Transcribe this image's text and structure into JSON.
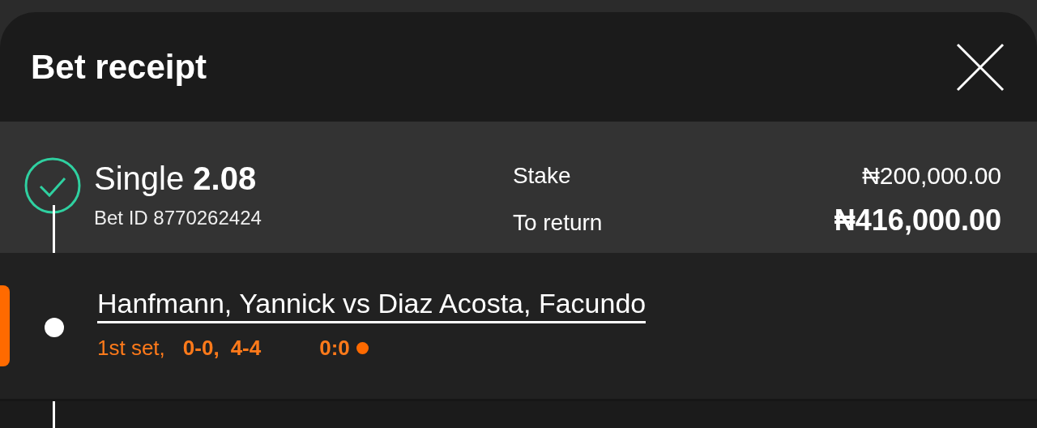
{
  "sheet": {
    "title": "Bet receipt"
  },
  "bet": {
    "confirmed": true,
    "title": "Single **2.08**",
    "bet_id": "Bet ID 8770262424",
    "stake_label": "Stake",
    "stake": "₦200,000.00",
    "return_label": "To return",
    "return": "₦416,000.00"
  },
  "selections": [
    {
      "event": "Hanfmann, Yannick vs Diaz Acosta, Facundo",
      "live": true,
      "period": "1st set,",
      "sets": "0-0,",
      "games": "4-4",
      "points": "0:0",
      "serving": true
    }
  ]
}
